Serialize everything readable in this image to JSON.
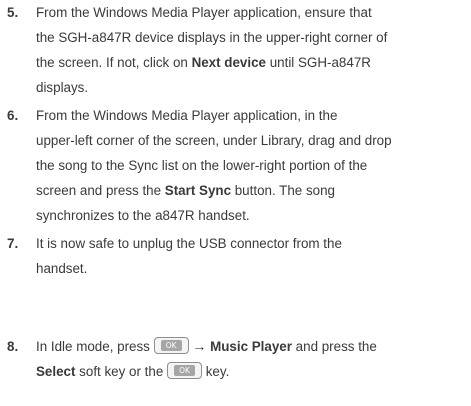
{
  "steps": [
    {
      "number": "5.",
      "lines": [
        [
          "From the Windows Media Player application, ensure that"
        ],
        [
          "the SGH-a847R device displays in the upper-right corner of"
        ],
        [
          "the screen. If not, click on ",
          "Next device",
          " until SGH-a847R"
        ],
        [
          "displays."
        ]
      ]
    },
    {
      "number": "6.",
      "lines": [
        [
          "From the Windows Media Player application, in the"
        ],
        [
          "upper-left corner of the screen, under Library, drag and drop"
        ],
        [
          "the song to the Sync list on the lower-right portion of the"
        ],
        [
          "screen and press the ",
          "Start Sync",
          " button. The song"
        ],
        [
          "synchronizes to the a847R handset."
        ]
      ]
    },
    {
      "number": "7.",
      "lines": [
        [
          "It is now safe to unplug the USB connector from the"
        ],
        [
          "handset."
        ]
      ]
    },
    {
      "number": "8.",
      "lines": [
        [
          "In Idle mode, press ",
          "Music Player",
          " and press the"
        ],
        [
          "Select",
          " soft key or the ",
          " key."
        ]
      ]
    }
  ],
  "ok_key_label": "OK",
  "arrow_symbol": "→",
  "icons": {
    "ok_key": "ok-key-icon",
    "arrow": "right-arrow-icon"
  }
}
